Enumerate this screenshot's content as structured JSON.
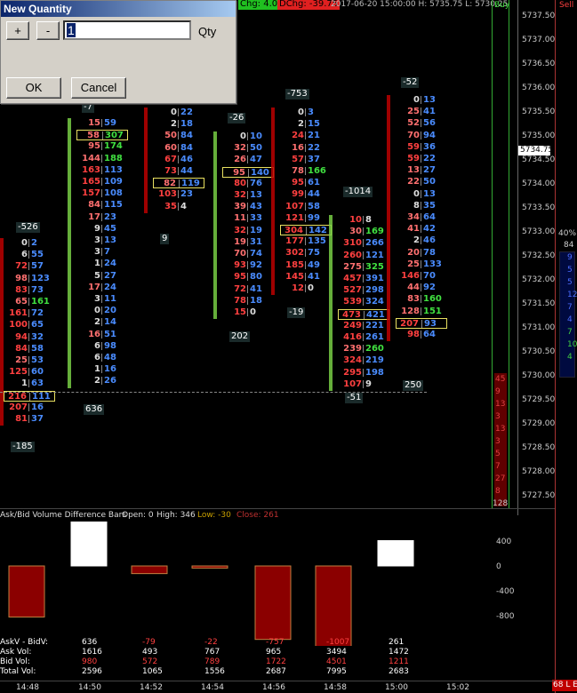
{
  "dialog": {
    "title": "New Quantity",
    "plus_label": "+",
    "minus_label": "-",
    "qty_value": "1",
    "qty_label": "Qty",
    "ok_label": "OK",
    "cancel_label": "Cancel"
  },
  "header": {
    "chg": "Chg: 4.00",
    "dchg": "DChg: -39.75",
    "info": "2017-06-20 15:00:00  H: 5735.75  L: 5730.25",
    "buy_label": "Buy",
    "sell_label": "Sell"
  },
  "price_axis": {
    "labels": [
      "5737.50",
      "5737.00",
      "5736.50",
      "5736.00",
      "5735.50",
      "5735.00",
      "5734.50",
      "5734.00",
      "5733.50",
      "5733.00",
      "5732.50",
      "5732.00",
      "5731.50",
      "5731.00",
      "5730.50",
      "5730.00",
      "5729.50",
      "5729.00",
      "5728.50",
      "5728.00",
      "5727.50"
    ],
    "current_price": "5734.75"
  },
  "right_panel": {
    "pct": "40%",
    "total": "84",
    "buy_count": "128",
    "sell_count": "68 L E",
    "right_numbers": [
      "9",
      "5",
      "5",
      "12",
      "7",
      "4",
      "7",
      "10",
      "4"
    ],
    "buy_numbers": [
      "45",
      "9",
      "13",
      "3",
      "13",
      "3",
      "5",
      "7",
      "27",
      "8"
    ]
  },
  "footprint": {
    "columns": [
      {
        "delta_top": "",
        "delta_bottom": "-185",
        "rows": [
          [
            "0",
            "2"
          ],
          [
            "6",
            "55"
          ],
          [
            "72",
            "57"
          ],
          [
            "98",
            "123"
          ],
          [
            "83",
            "73"
          ],
          [
            "65",
            "161"
          ],
          [
            "161",
            "72"
          ],
          [
            "100",
            "65"
          ],
          [
            "94",
            "32"
          ],
          [
            "84",
            "58"
          ],
          [
            "25",
            "53"
          ],
          [
            "125",
            "60"
          ],
          [
            "1",
            "63"
          ],
          [
            "216",
            "111"
          ],
          [
            "207",
            "16"
          ],
          [
            "81",
            "37"
          ]
        ],
        "side_label": "-526"
      },
      {
        "delta_top": "-7",
        "delta_bottom": "636",
        "rows": [
          [
            "15",
            "59"
          ],
          [
            "58",
            "307"
          ],
          [
            "95",
            "174"
          ],
          [
            "144",
            "188"
          ],
          [
            "163",
            "113"
          ],
          [
            "165",
            "109"
          ],
          [
            "157",
            "108"
          ],
          [
            "84",
            "115"
          ],
          [
            "17",
            "23"
          ],
          [
            "9",
            "45"
          ],
          [
            "3",
            "13"
          ],
          [
            "3",
            "7"
          ],
          [
            "1",
            "24"
          ],
          [
            "5",
            "27"
          ],
          [
            "17",
            "24"
          ],
          [
            "3",
            "11"
          ],
          [
            "0",
            "20"
          ],
          [
            "2",
            "14"
          ],
          [
            "16",
            "51"
          ],
          [
            "6",
            "98"
          ],
          [
            "6",
            "48"
          ],
          [
            "1",
            "16"
          ],
          [
            "2",
            "26"
          ]
        ]
      },
      {
        "delta_top": "",
        "delta_bottom": "9",
        "rows": [
          [
            "0",
            "22"
          ],
          [
            "2",
            "18"
          ],
          [
            "50",
            "84"
          ],
          [
            "60",
            "84"
          ],
          [
            "67",
            "46"
          ],
          [
            "73",
            "44"
          ],
          [
            "82",
            "119"
          ],
          [
            "103",
            "23"
          ],
          [
            "35",
            "4"
          ]
        ]
      },
      {
        "delta_top": "-26",
        "delta_bottom": "202",
        "rows": [
          [
            "0",
            "10"
          ],
          [
            "32",
            "50"
          ],
          [
            "26",
            "47"
          ],
          [
            "95",
            "140"
          ],
          [
            "80",
            "76"
          ],
          [
            "32",
            "13"
          ],
          [
            "39",
            "43"
          ],
          [
            "11",
            "33"
          ],
          [
            "32",
            "19"
          ],
          [
            "19",
            "31"
          ],
          [
            "70",
            "74"
          ],
          [
            "93",
            "92"
          ],
          [
            "95",
            "80"
          ],
          [
            "72",
            "41"
          ],
          [
            "78",
            "18"
          ],
          [
            "15",
            "0"
          ]
        ]
      },
      {
        "delta_top": "-753",
        "delta_bottom": "-19",
        "rows": [
          [
            "0",
            "3"
          ],
          [
            "2",
            "15"
          ],
          [
            "24",
            "21"
          ],
          [
            "16",
            "22"
          ],
          [
            "57",
            "37"
          ],
          [
            "78",
            "166"
          ],
          [
            "95",
            "61"
          ],
          [
            "99",
            "44"
          ],
          [
            "107",
            "58"
          ],
          [
            "121",
            "99"
          ],
          [
            "304",
            "142"
          ],
          [
            "177",
            "135"
          ],
          [
            "302",
            "75"
          ],
          [
            "185",
            "49"
          ],
          [
            "145",
            "41"
          ],
          [
            "12",
            "0"
          ]
        ]
      },
      {
        "delta_top": "-1014",
        "delta_bottom": "-51",
        "rows": [
          [
            "10",
            "8"
          ],
          [
            "30",
            "169"
          ],
          [
            "310",
            "266"
          ],
          [
            "260",
            "121"
          ],
          [
            "275",
            "325"
          ],
          [
            "457",
            "391"
          ],
          [
            "527",
            "298"
          ],
          [
            "539",
            "324"
          ],
          [
            "473",
            "421"
          ],
          [
            "249",
            "221"
          ],
          [
            "416",
            "261"
          ],
          [
            "239",
            "260"
          ],
          [
            "324",
            "219"
          ],
          [
            "295",
            "198"
          ],
          [
            "107",
            "9"
          ]
        ]
      },
      {
        "delta_top": "-52",
        "delta_bottom": "250",
        "rows": [
          [
            "0",
            "13"
          ],
          [
            "25",
            "41"
          ],
          [
            "52",
            "56"
          ],
          [
            "70",
            "94"
          ],
          [
            "59",
            "36"
          ],
          [
            "59",
            "22"
          ],
          [
            "13",
            "27"
          ],
          [
            "22",
            "50"
          ],
          [
            "0",
            "13"
          ],
          [
            "8",
            "35"
          ],
          [
            "34",
            "64"
          ],
          [
            "41",
            "42"
          ],
          [
            "2",
            "46"
          ],
          [
            "20",
            "78"
          ],
          [
            "25",
            "133"
          ],
          [
            "146",
            "70"
          ],
          [
            "44",
            "92"
          ],
          [
            "83",
            "160"
          ],
          [
            "128",
            "151"
          ],
          [
            "207",
            "93"
          ],
          [
            "98",
            "64"
          ]
        ]
      }
    ]
  },
  "lower_panel": {
    "title": "Ask/Bid Volume Difference Bars",
    "open": "Open: 0",
    "high": "High: 346",
    "low": "Low: -30",
    "close": "Close: 261",
    "axis": [
      "400",
      "0",
      "-400",
      "-800"
    ],
    "rows": {
      "labels": [
        "AskV - BidV:",
        "Ask Vol:",
        "Bid Vol:",
        "Total Vol:"
      ],
      "cols": [
        [
          "636",
          "1616",
          "980",
          "2596"
        ],
        [
          "-79",
          "493",
          "572",
          "1065"
        ],
        [
          "-22",
          "767",
          "789",
          "1556"
        ],
        [
          "-757",
          "965",
          "1722",
          "2687"
        ],
        [
          "-1007",
          "3494",
          "4501",
          "7995"
        ],
        [
          "261",
          "1472",
          "1211",
          "2683"
        ]
      ]
    },
    "bar_values": [
      -526,
      636,
      -79,
      -22,
      -757,
      -1007,
      261
    ]
  },
  "time_axis": [
    "14:48",
    "14:50",
    "14:52",
    "14:54",
    "14:56",
    "14:58",
    "15:00",
    "15:02"
  ],
  "colors": {
    "bid": "#ff4040",
    "ask": "#4a8cff",
    "green": "#40e040",
    "highlight": "#e8e060",
    "bar_red": "#8b0000"
  }
}
